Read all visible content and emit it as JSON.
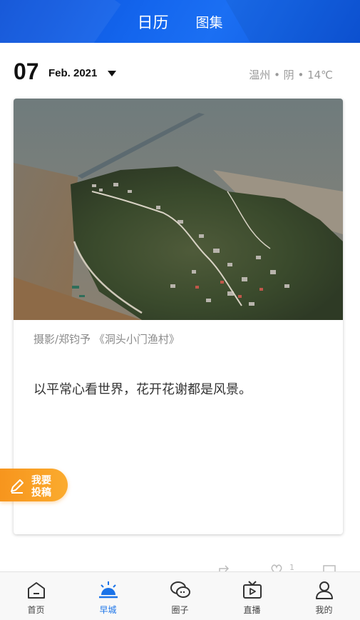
{
  "header": {
    "tabs": [
      {
        "label": "日历",
        "active": true
      },
      {
        "label": "图集",
        "active": false
      }
    ],
    "colors": {
      "gradient_start": "#0a4fd6",
      "gradient_end": "#1b6ff3"
    }
  },
  "date": {
    "day": "07",
    "month_year": "Feb. 2021",
    "weather": "温州 • 阴 • 14℃"
  },
  "card": {
    "credit": "摄影/郑钧予 《洞头小门渔村》",
    "quote": "以平常心看世界，花开花谢都是风景。"
  },
  "submit_button": {
    "line1": "我要",
    "line2": "投稿",
    "color": "#f7951d"
  },
  "actions": {
    "like_count": "1",
    "icons": [
      "share-icon",
      "heart-icon",
      "comment-icon"
    ]
  },
  "bottom_nav": {
    "items": [
      {
        "label": "首页",
        "icon": "home-icon",
        "active": false
      },
      {
        "label": "早城",
        "icon": "sunrise-icon",
        "active": true
      },
      {
        "label": "圈子",
        "icon": "chat-icon",
        "active": false
      },
      {
        "label": "直播",
        "icon": "tv-icon",
        "active": false
      },
      {
        "label": "我的",
        "icon": "user-icon",
        "active": false
      }
    ],
    "active_color": "#1a73e8"
  }
}
